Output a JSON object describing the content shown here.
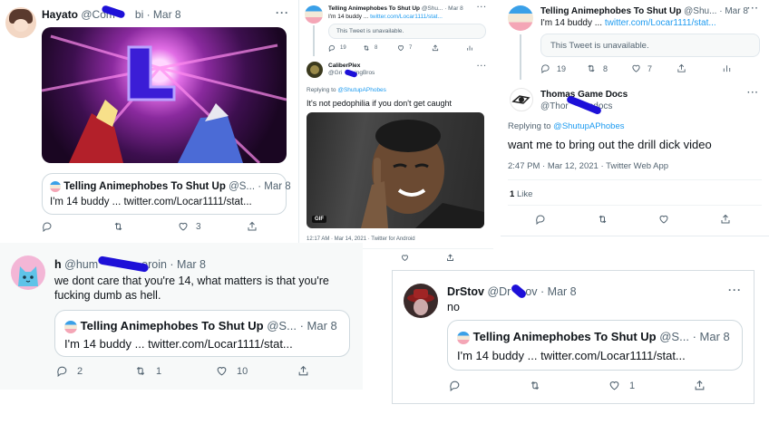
{
  "quoted": {
    "name": "Telling Animephobes To Shut Up",
    "handle": "@S...",
    "handle_small": "@Shu...",
    "date": "Mar 8",
    "text": "I'm 14 buddy ... twitter.com/Locar1111/stat...",
    "text_p2": "I'm 14 buddy ...",
    "link_p2": "twitter.com/Locar1111/stat...",
    "text_p3": "I'm 14 buddy ...",
    "link_p3": "twitter.com/Locar1111/stat..."
  },
  "tweet1": {
    "name": "Hayato",
    "handle": "@Com",
    "handle_tail": "bi",
    "date": "· Mar 8",
    "actions": {
      "replies": "",
      "retweets": "",
      "likes": "3"
    }
  },
  "tweet2": {
    "top_handle": "@Shu... · Mar 8",
    "unavailable": "This Tweet is unavailable.",
    "unavail_actions": {
      "replies": "19",
      "retweets": "8",
      "likes": "7"
    },
    "name": "CaliberPlex",
    "handle": "@Gri",
    "handle_tail": "ingBros",
    "replying_prefix": "Replying to",
    "replying_to": "@ShutupAPhobes",
    "text": "It's not pedophilia if you don't get caught",
    "gif_label": "GIF",
    "timestamp": "12:17 AM · Mar 14, 2021 · Twitter for Android"
  },
  "tweet3": {
    "top_handle": "@Shu... · Mar 8",
    "unavailable": "This Tweet is unavailable.",
    "unavail_actions": {
      "replies": "19",
      "retweets": "8",
      "likes": "7"
    },
    "name": "Thomas Game Docs",
    "handle": "@Thor",
    "handle_tail": "edocs",
    "replying_prefix": "Replying to",
    "replying_to": "@ShutupAPhobes",
    "text": "want me to bring out the drill dick video",
    "timestamp": "2:47 PM · Mar 12, 2021 · Twitter Web App",
    "likes_count": "1",
    "likes_label": "Like"
  },
  "tweet4": {
    "name": "h",
    "handle": "@hum",
    "handle_tail": "eroin",
    "date": "· Mar 8",
    "text_line1": "we dont care that you're 14, what matters is that you're",
    "text_line2": "fucking dumb as hell.",
    "actions": {
      "replies": "2",
      "retweets": "1",
      "likes": "10"
    }
  },
  "tweet5": {
    "name": "DrStov",
    "handle": "@Dr",
    "handle_tail": "ov",
    "date": "· Mar 8",
    "text": "no",
    "actions": {
      "replies": "",
      "retweets": "",
      "likes": "1"
    }
  },
  "more_label": "···",
  "colors": {
    "accent": "#1d9bf0",
    "muted": "#536471",
    "scribble": "#1d10d8"
  }
}
